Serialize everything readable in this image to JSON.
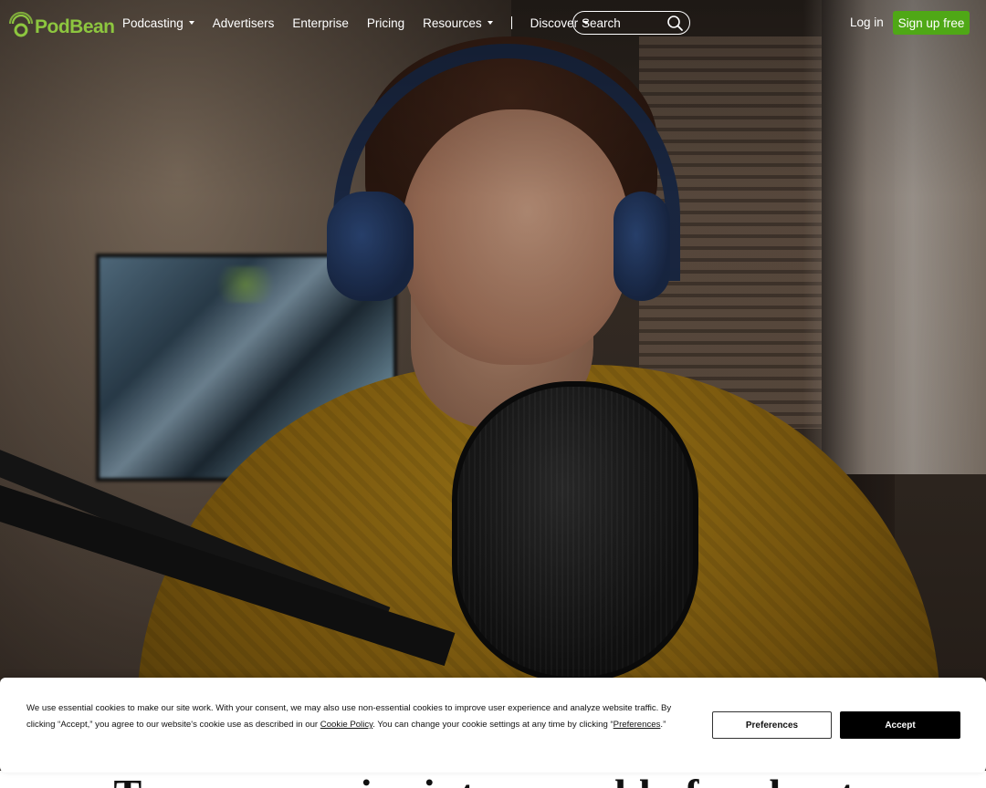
{
  "brand": {
    "logo_text": "PodBean",
    "accent": "#8dc63f"
  },
  "nav": {
    "items": [
      {
        "label": "Podcasting",
        "dropdown": true
      },
      {
        "label": "Advertisers",
        "dropdown": false
      },
      {
        "label": "Enterprise",
        "dropdown": false
      },
      {
        "label": "Pricing",
        "dropdown": false
      },
      {
        "label": "Resources",
        "dropdown": true
      }
    ],
    "discover": {
      "label": "Discover",
      "dropdown": true
    },
    "search": {
      "placeholder": "Search",
      "icon": "search-icon"
    },
    "login_label": "Log in",
    "signup_label": "Sign up free",
    "signup_color": "#4fa816"
  },
  "hero": {
    "image": "woman-with-headphones-at-microphone",
    "headline": "Turn your voice into a world of podcasts"
  },
  "cookie_banner": {
    "text_part1": "We use essential cookies to make our site work. With your consent, we may also use non-essential cookies to improve user experience and analyze website traffic. By clicking “Accept,” you agree to our website's cookie use as described in our ",
    "policy_link": "Cookie Policy",
    "text_part2": ". You can change your cookie settings at any time by clicking “",
    "preferences_link": "Preferences",
    "text_part3": ".”",
    "preferences_button": "Preferences",
    "accept_button": "Accept"
  }
}
